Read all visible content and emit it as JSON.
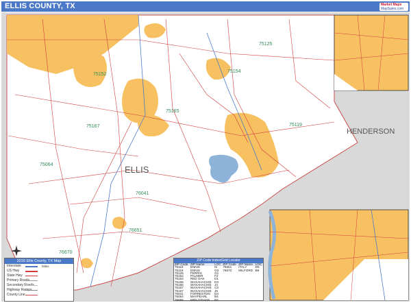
{
  "title": "ELLIS COUNTY, TX",
  "logo": {
    "line1": "Market Maps",
    "line2": "MapSales.com"
  },
  "county_label": "ELLIS",
  "neighbor_label": "HENDERSON",
  "zip_labels": [
    "75125",
    "75154",
    "75165",
    "75167",
    "75119",
    "75152",
    "75064",
    "76041",
    "76651",
    "76670"
  ],
  "legend": {
    "title": "2016 Ellis County, TX Map",
    "rows": [
      "Interstate",
      "US Hwy",
      "State Hwy",
      "Primary Roads",
      "Secondary Roads",
      "Highway Ramps",
      "County Line",
      "Boundary"
    ],
    "scale_text": "Miles"
  },
  "zip_index": {
    "title": "ZIP Code Index/Grid Locator",
    "headers": [
      "ZIP Code",
      "ZIP Name",
      "LOC",
      "ZIP Code",
      "ZIP Name",
      "LOC"
    ],
    "rows": [
      [
        "75119",
        "ENNIS",
        "I6",
        "76651",
        "ITALY",
        "D5"
      ],
      [
        "75119",
        "ENNIS",
        "G3",
        "76670",
        "MILFORD",
        "B6"
      ],
      [
        "75125",
        "FERRIS",
        "G1",
        "",
        "",
        ""
      ],
      [
        "75152",
        "PALMER",
        "F2",
        "",
        "",
        ""
      ],
      [
        "75154",
        "RED OAK",
        "D1",
        "",
        "",
        ""
      ],
      [
        "75165",
        "WAXAHACHIE",
        "D3",
        "",
        "",
        ""
      ],
      [
        "75165",
        "WAXAHACHIE",
        "J4",
        "",
        "",
        ""
      ],
      [
        "75167",
        "WAXAHACHIE",
        "C3",
        "",
        "",
        ""
      ],
      [
        "75167",
        "WAXAHACHIE",
        "J5",
        "",
        "",
        ""
      ],
      [
        "76041",
        "FORRESTON",
        "D4",
        "",
        "",
        ""
      ],
      [
        "76064",
        "MAYPEARL",
        "B4",
        "",
        "",
        ""
      ],
      [
        "76065",
        "MIDLOTHIAN",
        "B2",
        "",
        "",
        ""
      ]
    ]
  },
  "colors": {
    "urban": "#f7c162",
    "county_fill": "#ffffff",
    "outside": "#d9d9d9",
    "water": "#8eb3d9",
    "road": "#d23b3b",
    "title_bar": "#4c78c8"
  }
}
